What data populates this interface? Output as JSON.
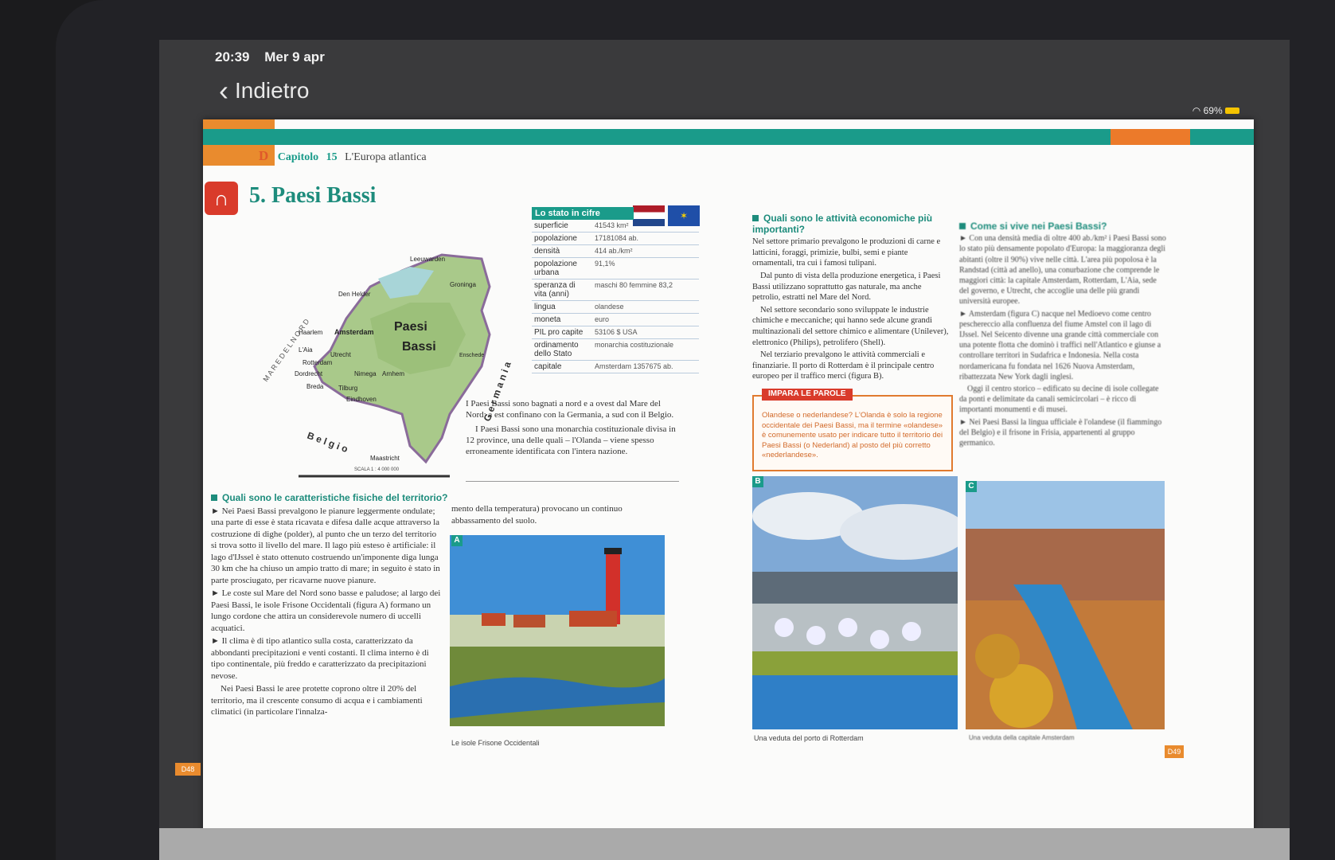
{
  "status": {
    "time": "20:39",
    "date": "Mer 9 apr",
    "battery": "69%"
  },
  "nav": {
    "back_label": "Indietro"
  },
  "toolbar": [
    "hierarchy-icon",
    "edit-note-icon",
    "bookmark-icon",
    "search-icon",
    "grid-icon",
    "list-icon",
    "user-icon"
  ],
  "book": {
    "chapter_letter": "D",
    "chapter_word": "Capitolo",
    "chapter_num": "15",
    "chapter_title": "L'Europa atlantica",
    "section_title": "5. Paesi Bassi",
    "page_left": "D48",
    "page_right": "D49"
  },
  "map": {
    "country_name_1": "Paesi",
    "country_name_2": "Bassi",
    "sea_label": "M A R E   D E L   N O R D",
    "belgio": "B e l g i o",
    "germania": "G e r m a n i a",
    "cities": [
      "Amsterdam",
      "Haarlem",
      "L'Aia",
      "Rotterdam",
      "Dordrecht",
      "Utrecht",
      "Breda",
      "Tilburg",
      "Eindhoven",
      "Nimega",
      "Arnhem",
      "Maastricht",
      "Groninga",
      "Leeuwarden",
      "Den Helder",
      "Enschede"
    ],
    "scale_label": "SCALA 1 : 4 000 000"
  },
  "stats": {
    "header": "Lo stato in cifre",
    "rows": [
      {
        "k": "superficie",
        "v": "41543 km²"
      },
      {
        "k": "popolazione",
        "v": "17181084 ab."
      },
      {
        "k": "densità",
        "v": "414 ab./km²"
      },
      {
        "k": "popolazione urbana",
        "v": "91,1%"
      },
      {
        "k": "speranza di vita (anni)",
        "v": "maschi 80 femmine 83,2"
      },
      {
        "k": "lingua",
        "v": "olandese"
      },
      {
        "k": "moneta",
        "v": "euro"
      },
      {
        "k": "PIL pro capite",
        "v": "53106 $ USA"
      },
      {
        "k": "ordinamento dello Stato",
        "v": "monarchia costituzionale"
      },
      {
        "k": "capitale",
        "v": "Amsterdam 1357675 ab."
      }
    ]
  },
  "intro": {
    "p1": "I Paesi Bassi sono bagnati a nord e a ovest dal Mare del Nord; a est confinano con la Germania, a sud con il Belgio.",
    "p2": "I Paesi Bassi sono una monarchia costituzionale divisa in 12 province, una delle quali – l'Olanda – viene spesso erroneamente identificata con l'intera nazione."
  },
  "physical": {
    "heading": "Quali sono le caratteristiche fisiche del territorio?",
    "p1": "► Nei Paesi Bassi prevalgono le pianure leggermente ondulate; una parte di esse è stata ricavata e difesa dalle acque attraverso la costruzione di dighe (polder), al punto che un terzo del territorio si trova sotto il livello del mare. Il lago più esteso è artificiale: il lago d'IJssel è stato ottenuto costruendo un'imponente diga lunga 30 km che ha chiuso un ampio tratto di mare; in seguito è stato in parte prosciugato, per ricavarne nuove pianure.",
    "p2": "► Le coste sul Mare del Nord sono basse e paludose; al largo dei Paesi Bassi, le isole Frisone Occidentali (figura A) formano un lungo cordone che attira un considerevole numero di uccelli acquatici.",
    "p3": "► Il clima è di tipo atlantico sulla costa, caratterizzato da abbondanti precipitazioni e venti costanti. Il clima interno è di tipo continentale, più freddo e caratterizzato da precipitazioni nevose.",
    "p4": "Nei Paesi Bassi le aree protette coprono oltre il 20% del territorio, ma il crescente consumo di acqua e i cambiamenti climatici (in particolare l'innalza-",
    "p5": "mento della temperatura) provocano un continuo abbassamento del suolo."
  },
  "figA": {
    "letter": "A",
    "caption": "Le isole Frisone Occidentali"
  },
  "economy": {
    "heading": "Quali sono le attività economiche più importanti?",
    "p1": "Nel settore primario prevalgono le produzioni di carne e latticini, foraggi, primizie, bulbi, semi e piante ornamentali, tra cui i famosi tulipani.",
    "p2": "Dal punto di vista della produzione energetica, i Paesi Bassi utilizzano soprattutto gas naturale, ma anche petrolio, estratti nel Mare del Nord.",
    "p3": "Nel settore secondario sono sviluppate le industrie chimiche e meccaniche; qui hanno sede alcune grandi multinazionali del settore chimico e alimentare (Unilever), elettronico (Philips), petrolifero (Shell).",
    "p4": "Nel terziario prevalgono le attività commerciali e finanziarie. Il porto di Rotterdam è il principale centro europeo per il traffico merci (figura B)."
  },
  "impara": {
    "tag": "IMPARA LE PAROLE",
    "text": "Olandese o nederlandese? L'Olanda è solo la regione occidentale dei Paesi Bassi, ma il termine «olandese» è comunemente usato per indicare tutto il territorio dei Paesi Bassi (o Nederland) al posto del più corretto «nederlandese»."
  },
  "life": {
    "heading": "Come si vive nei Paesi Bassi?",
    "p1": "► Con una densità media di oltre 400 ab./km² i Paesi Bassi sono lo stato più densamente popolato d'Europa: la maggioranza degli abitanti (oltre il 90%) vive nelle città. L'area più popolosa è la Randstad (città ad anello), una conurbazione che comprende le maggiori città: la capitale Amsterdam, Rotterdam, L'Aia, sede del governo, e Utrecht, che accoglie una delle più grandi università europee.",
    "p2": "► Amsterdam (figura C) nacque nel Medioevo come centro peschereccio alla confluenza del fiume Amstel con il lago di IJssel. Nel Seicento divenne una grande città commerciale con una potente flotta che dominò i traffici nell'Atlantico e giunse a controllare territori in Sudafrica e Indonesia. Nella costa nordamericana fu fondata nel 1626 Nuova Amsterdam, ribattezzata New York dagli inglesi.",
    "p3": "Oggi il centro storico – edificato su decine di isole collegate da ponti e delimitate da canali semicircolari – è ricco di importanti monumenti e di musei.",
    "p4": "► Nei Paesi Bassi la lingua ufficiale è l'olandese (il fiammingo del Belgio) e il frisone in Frisia, appartenenti al gruppo germanico."
  },
  "figB": {
    "letter": "B",
    "caption": "Una veduta del porto di Rotterdam"
  },
  "figC": {
    "letter": "C",
    "caption": "Una veduta della capitale Amsterdam"
  }
}
